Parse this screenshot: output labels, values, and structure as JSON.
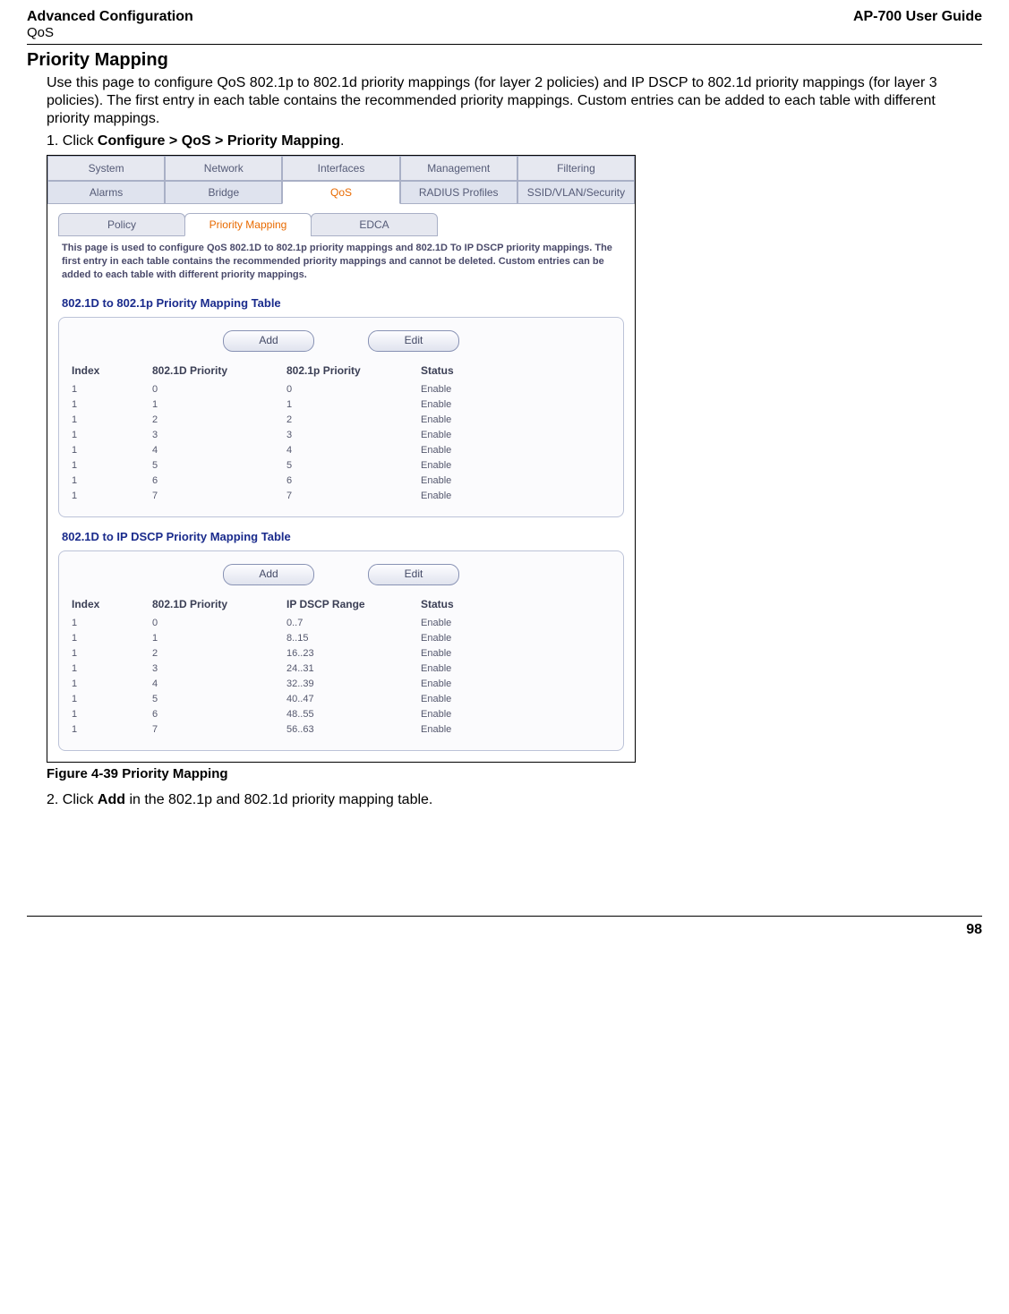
{
  "header": {
    "left_title": "Advanced Configuration",
    "left_sub": "QoS",
    "right_title": "AP-700 User Guide"
  },
  "section_title": "Priority Mapping",
  "intro": "Use this page to configure QoS 802.1p to 802.1d priority mappings (for layer 2 policies) and IP DSCP to 802.1d priority mappings (for layer 3 policies). The first entry in each table contains the recommended priority mappings. Custom entries can be added to each table with different priority mappings.",
  "step1_prefix": "1.  Click ",
  "step1_bold": "Configure > QoS > Priority Mapping",
  "step1_suffix": ".",
  "tabs1": [
    "System",
    "Network",
    "Interfaces",
    "Management",
    "Filtering"
  ],
  "tabs2": [
    "Alarms",
    "Bridge",
    "QoS",
    "RADIUS Profiles",
    "SSID/VLAN/Security"
  ],
  "subtabs": [
    "Policy",
    "Priority Mapping",
    "EDCA"
  ],
  "desc": "This page is used to configure QoS 802.1D to 802.1p priority mappings and 802.1D To IP DSCP priority mappings. The first entry in each table contains the recommended priority mappings and cannot be deleted. Custom entries can be added to each table with different priority mappings.",
  "table1": {
    "title": "802.1D to 802.1p Priority Mapping Table",
    "add": "Add",
    "edit": "Edit",
    "headers": [
      "Index",
      "802.1D Priority",
      "802.1p Priority",
      "Status"
    ],
    "rows": [
      [
        "1",
        "0",
        "0",
        "Enable"
      ],
      [
        "1",
        "1",
        "1",
        "Enable"
      ],
      [
        "1",
        "2",
        "2",
        "Enable"
      ],
      [
        "1",
        "3",
        "3",
        "Enable"
      ],
      [
        "1",
        "4",
        "4",
        "Enable"
      ],
      [
        "1",
        "5",
        "5",
        "Enable"
      ],
      [
        "1",
        "6",
        "6",
        "Enable"
      ],
      [
        "1",
        "7",
        "7",
        "Enable"
      ]
    ]
  },
  "table2": {
    "title": "802.1D to IP DSCP Priority Mapping Table",
    "add": "Add",
    "edit": "Edit",
    "headers": [
      "Index",
      "802.1D Priority",
      "IP DSCP Range",
      "Status"
    ],
    "rows": [
      [
        "1",
        "0",
        "0..7",
        "Enable"
      ],
      [
        "1",
        "1",
        "8..15",
        "Enable"
      ],
      [
        "1",
        "2",
        "16..23",
        "Enable"
      ],
      [
        "1",
        "3",
        "24..31",
        "Enable"
      ],
      [
        "1",
        "4",
        "32..39",
        "Enable"
      ],
      [
        "1",
        "5",
        "40..47",
        "Enable"
      ],
      [
        "1",
        "6",
        "48..55",
        "Enable"
      ],
      [
        "1",
        "7",
        "56..63",
        "Enable"
      ]
    ]
  },
  "figure_caption": "Figure 4-39 Priority Mapping",
  "step2_prefix": "2.  Click ",
  "step2_bold": "Add",
  "step2_suffix": " in the 802.1p and 802.1d priority mapping table.",
  "page_number": "98"
}
